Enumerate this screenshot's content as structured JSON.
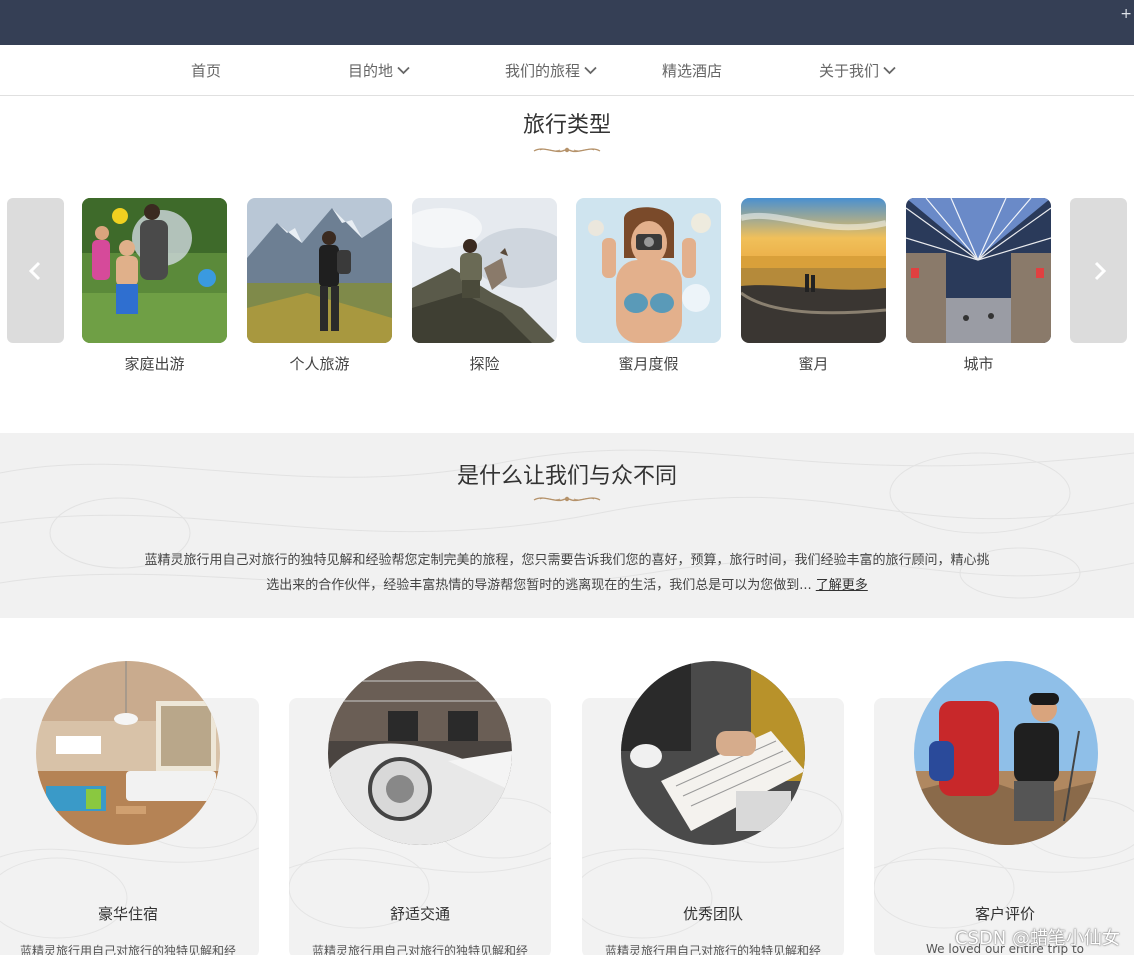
{
  "topbar": {
    "plus_icon": "+"
  },
  "nav": {
    "items": [
      {
        "label": "首页",
        "dropdown": false
      },
      {
        "label": "目的地",
        "dropdown": true
      },
      {
        "label": "我们的旅程",
        "dropdown": true
      },
      {
        "label": "精选酒店",
        "dropdown": false
      },
      {
        "label": "关于我们",
        "dropdown": true
      }
    ]
  },
  "travel_types": {
    "title": "旅行类型",
    "prev_icon": "chevron-left-icon",
    "next_icon": "chevron-right-icon",
    "items": [
      {
        "label": "家庭出游"
      },
      {
        "label": "个人旅游"
      },
      {
        "label": "探险"
      },
      {
        "label": "蜜月度假"
      },
      {
        "label": "蜜月"
      },
      {
        "label": "城市"
      }
    ]
  },
  "difference": {
    "title": "是什么让我们与众不同",
    "line1": "蓝精灵旅行用自己对旅行的独特见解和经验帮您定制完美的旅程，您只需要告诉我们您的喜好，预算，旅行时间，我们经验丰富的旅行顾问，精心挑",
    "line2": "选出来的合作伙伴，经验丰富热情的导游帮您暂时的逃离现在的生活，我们总是可以为您做到...",
    "more_link": "了解更多"
  },
  "features": [
    {
      "title": "豪华住宿",
      "desc": "蓝精灵旅行用自己对旅行的独特见解和经"
    },
    {
      "title": "舒适交通",
      "desc": "蓝精灵旅行用自己对旅行的独特见解和经"
    },
    {
      "title": "优秀团队",
      "desc": "蓝精灵旅行用自己对旅行的独特见解和经"
    },
    {
      "title": "客户评价",
      "desc": "We loved our entire trip to"
    }
  ],
  "watermark": "CSDN @蜡笔小仙女",
  "colors": {
    "topbar": "#353f55",
    "accent_gold": "#b5926a",
    "section_bg": "#f1f1f1"
  }
}
